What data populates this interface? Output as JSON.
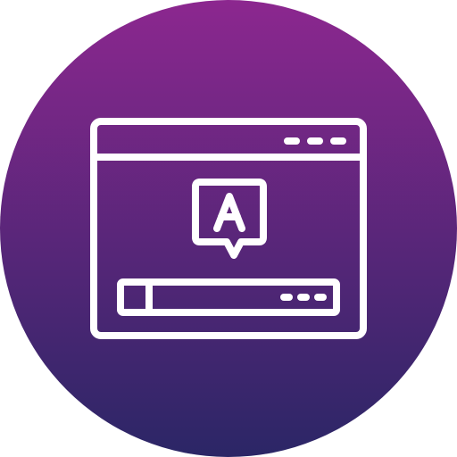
{
  "icon": {
    "name": "translation-browser-icon",
    "gradient_top": "#8c278f",
    "gradient_bottom": "#2b2666",
    "line_color": "#ffffff",
    "speech_bubble_letter": "A"
  }
}
